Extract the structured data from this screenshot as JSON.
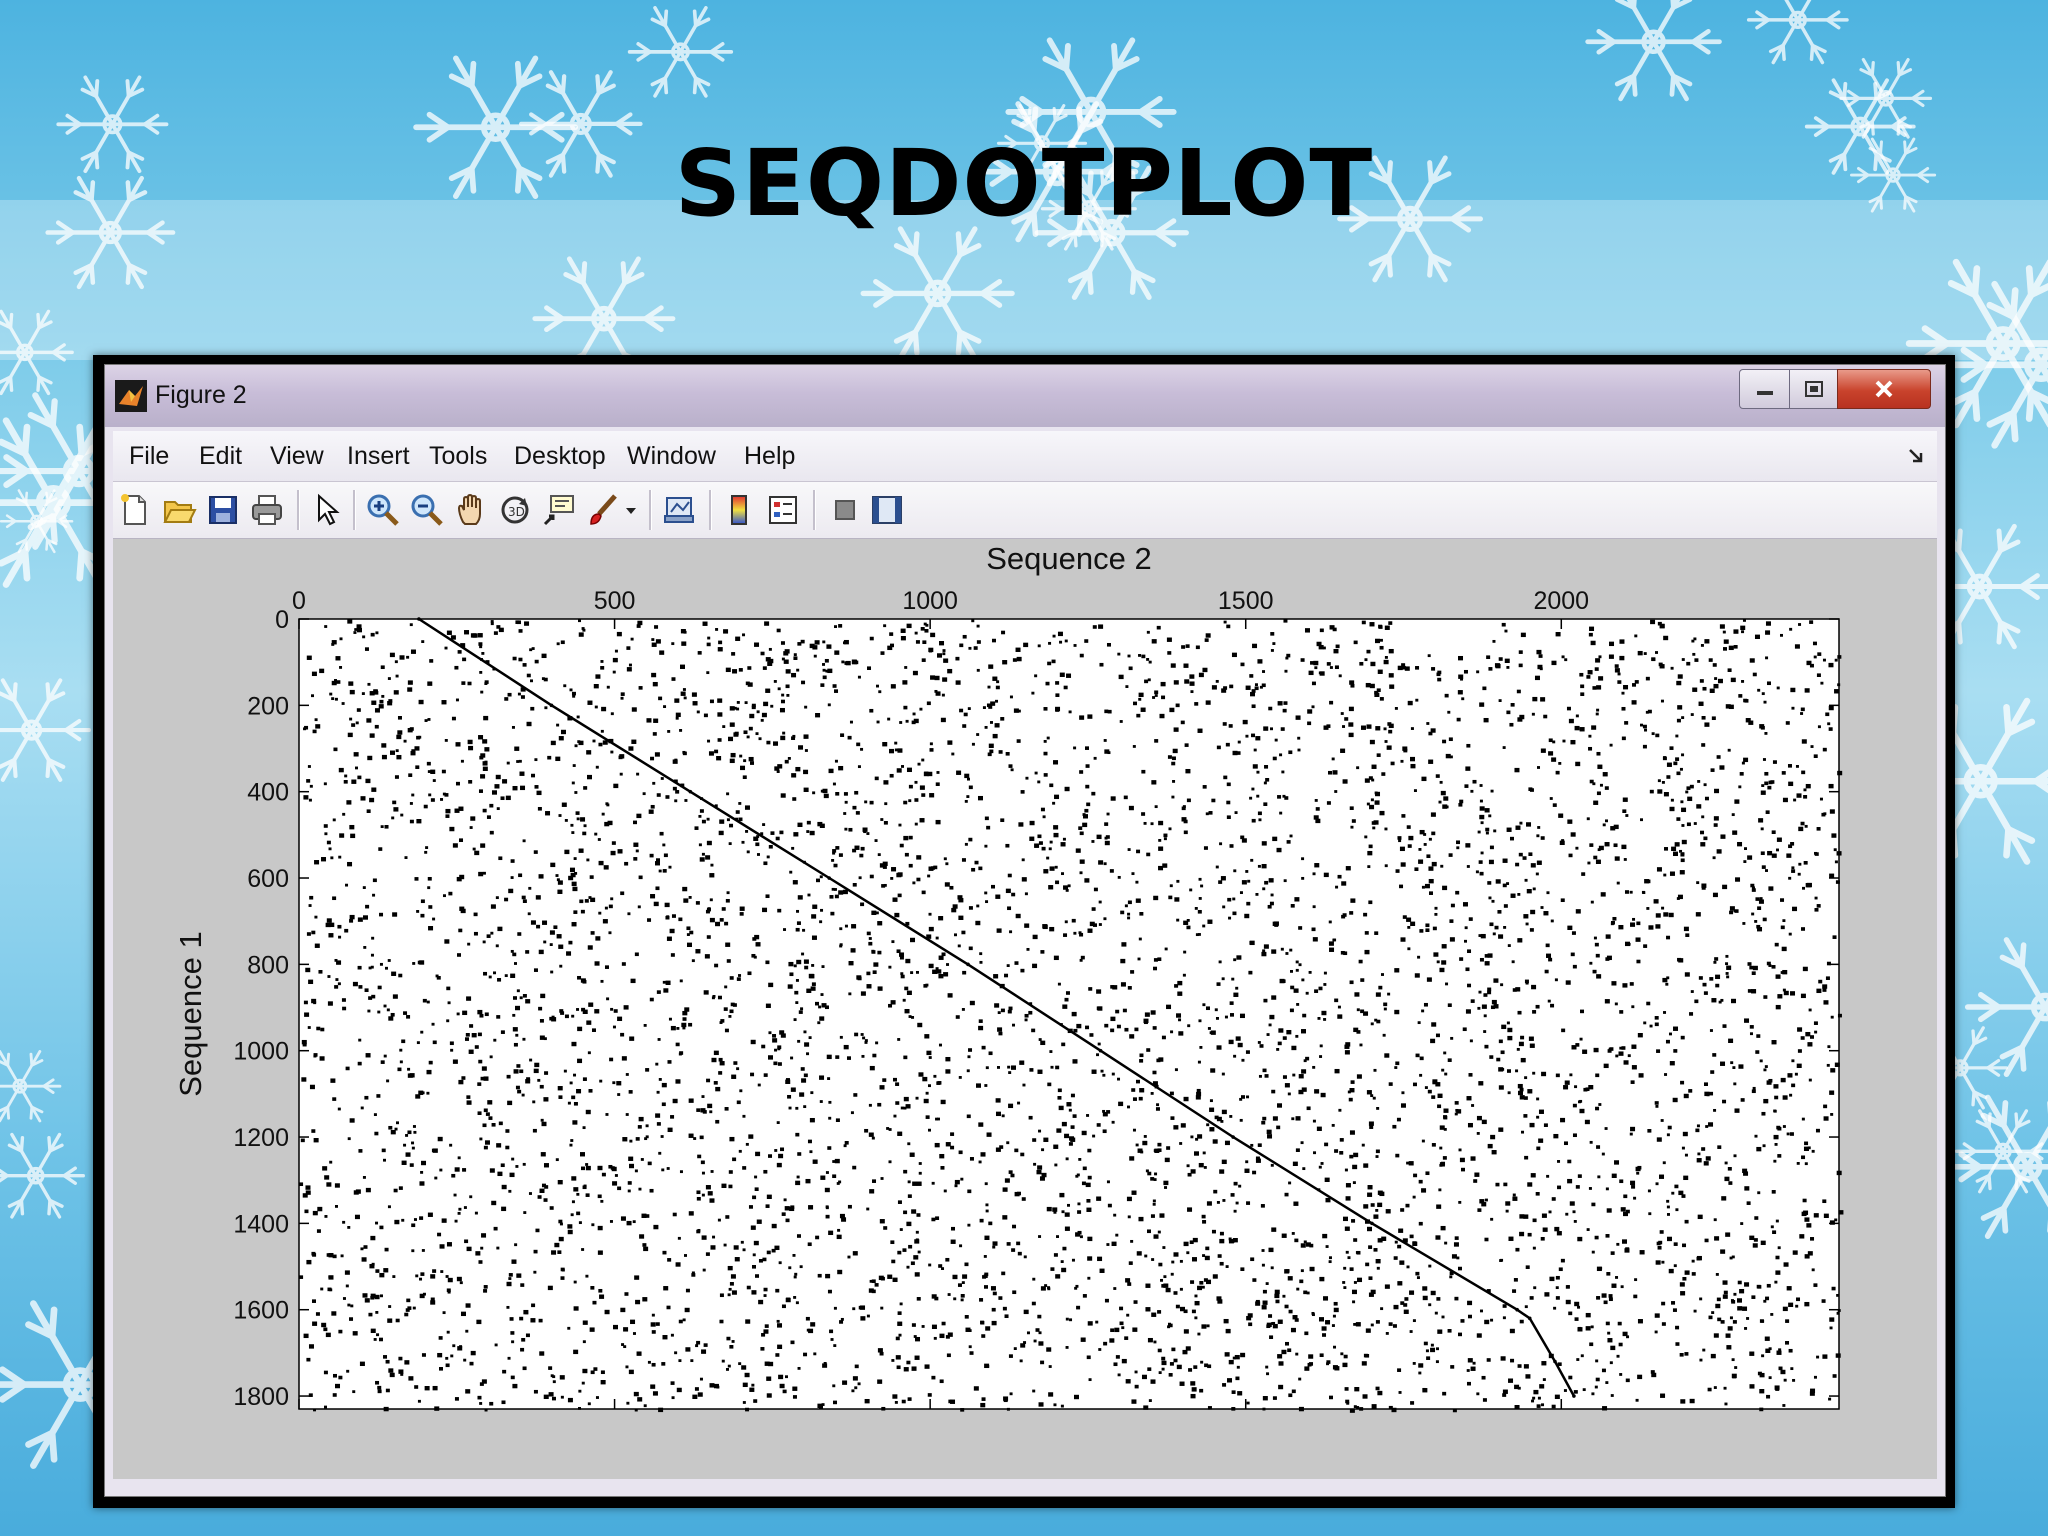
{
  "slide": {
    "title": "SEQDOTPLOT"
  },
  "window": {
    "title": "Figure 2",
    "controls": {
      "minimize": "minimize",
      "maximize": "maximize",
      "close": "close"
    }
  },
  "menu": {
    "items": [
      "File",
      "Edit",
      "View",
      "Insert",
      "Tools",
      "Desktop",
      "Window",
      "Help"
    ]
  },
  "toolbar": {
    "icons": [
      "new-figure-icon",
      "open-file-icon",
      "save-icon",
      "print-icon",
      "edit-plot-arrow-icon",
      "zoom-in-icon",
      "zoom-out-icon",
      "pan-hand-icon",
      "rotate-3d-icon",
      "data-cursor-icon",
      "brush-icon",
      "link-plot-icon",
      "insert-colorbar-icon",
      "insert-legend-icon",
      "hide-plot-tools-icon",
      "show-plot-tools-icon"
    ]
  },
  "chart_data": {
    "type": "scatter",
    "title": "",
    "xlabel": "Sequence 2",
    "ylabel": "Sequence 1",
    "xaxis_position": "top",
    "yaxis_reversed": true,
    "xlim": [
      0,
      2440
    ],
    "ylim": [
      0,
      1830
    ],
    "xticks": [
      0,
      500,
      1000,
      1500,
      2000
    ],
    "yticks": [
      0,
      200,
      400,
      600,
      800,
      1000,
      1200,
      1400,
      1600,
      1800
    ],
    "marker_color": "#000000",
    "background_noise": "dense random matches across the whole matrix",
    "diagonal_series": {
      "name": "",
      "points": [
        [
          190,
          0
        ],
        [
          400,
          200
        ],
        [
          620,
          400
        ],
        [
          840,
          600
        ],
        [
          1060,
          800
        ],
        [
          1270,
          1000
        ],
        [
          1480,
          1200
        ],
        [
          1700,
          1400
        ],
        [
          1930,
          1600
        ],
        [
          1950,
          1620
        ],
        [
          1990,
          1720
        ],
        [
          2020,
          1800
        ]
      ]
    },
    "grid": false
  }
}
